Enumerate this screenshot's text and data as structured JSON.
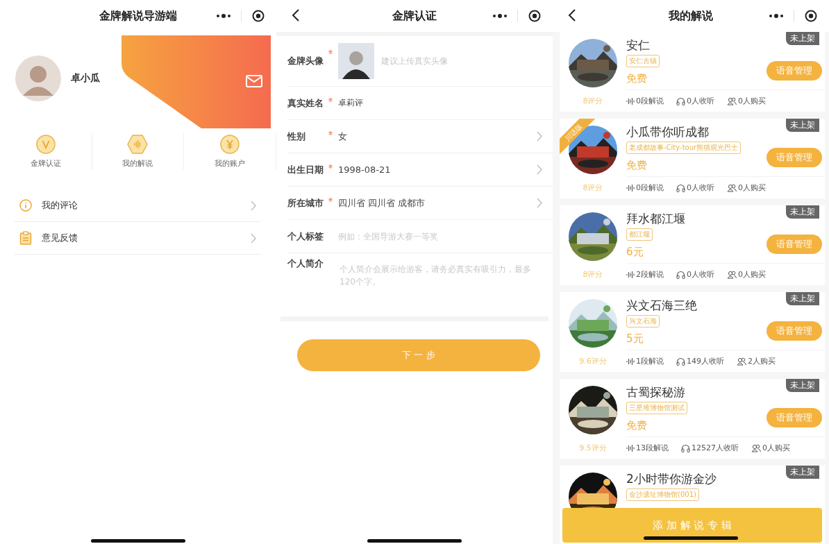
{
  "home": {
    "title": "金牌解说导游端",
    "user": {
      "name": "卓小瓜"
    },
    "shortcuts": [
      {
        "label": "金牌认证",
        "kind": "v"
      },
      {
        "label": "我的解说",
        "kind": "wave"
      },
      {
        "label": "我的账户",
        "kind": "yen"
      }
    ],
    "menu": [
      {
        "label": "我的评论",
        "kind": "info"
      },
      {
        "label": "意见反馈",
        "kind": "clipboard"
      }
    ]
  },
  "certification": {
    "title": "金牌认证",
    "fields": [
      {
        "label": "金牌头像",
        "required": true,
        "kind": "avatar",
        "placeholder": "建议上传真实头像"
      },
      {
        "label": "真实姓名",
        "required": true,
        "kind": "text",
        "value": "卓莉评"
      },
      {
        "label": "性别",
        "required": true,
        "kind": "select",
        "value": "女"
      },
      {
        "label": "出生日期",
        "required": true,
        "kind": "select",
        "value": "1998-08-21"
      },
      {
        "label": "所在城市",
        "required": true,
        "kind": "select",
        "value": "四川省 四川省 成都市"
      },
      {
        "label": "个人标签",
        "required": false,
        "kind": "text",
        "placeholder": "例如：全国导游大赛一等奖"
      },
      {
        "label": "个人简介",
        "required": false,
        "kind": "textarea",
        "placeholder": "个人简介会展示给游客，请务必真实有吸引力，最多120个字。"
      }
    ],
    "submit": "下 一 步"
  },
  "commentaries": {
    "title": "我的解说",
    "albums": [
      {
        "title": "安仁",
        "tag": "安仁古镇",
        "status": "未上架",
        "price": "免费",
        "rating": "8评分",
        "segments": "0段解说",
        "listens": "0人收听",
        "buyers": "0人购买",
        "action": "语音管理"
      },
      {
        "title": "小瓜带你听成都",
        "tag": "老成都故事-City-tour熊猫观光巴士",
        "status": "未上架",
        "ribbon": "川话版",
        "price": "免费",
        "rating": "8评分",
        "segments": "0段解说",
        "listens": "0人收听",
        "buyers": "0人购买",
        "action": "语音管理"
      },
      {
        "title": "拜水都江堰",
        "tag": "都江堰",
        "status": "未上架",
        "price": "6元",
        "rating": "8评分",
        "segments": "2段解说",
        "listens": "0人收听",
        "buyers": "0人购买",
        "action": "语音管理"
      },
      {
        "title": "兴文石海三绝",
        "tag": "兴文石海",
        "status": "未上架",
        "price": "5元",
        "rating": "9.6评分",
        "segments": "1段解说",
        "listens": "149人收听",
        "buyers": "2人购买",
        "action": "语音管理"
      },
      {
        "title": "古蜀探秘游",
        "tag": "三星堆博物馆测试",
        "status": "未上架",
        "price": "免费",
        "rating": "9.5评分",
        "segments": "13段解说",
        "listens": "12527人收听",
        "buyers": "0人购买",
        "action": "语音管理"
      },
      {
        "title": "2小时带你游金沙",
        "tag": "金沙遗址博物馆(001)",
        "status": "未上架"
      }
    ],
    "add_button": "添 加 解 说 专 辑"
  }
}
